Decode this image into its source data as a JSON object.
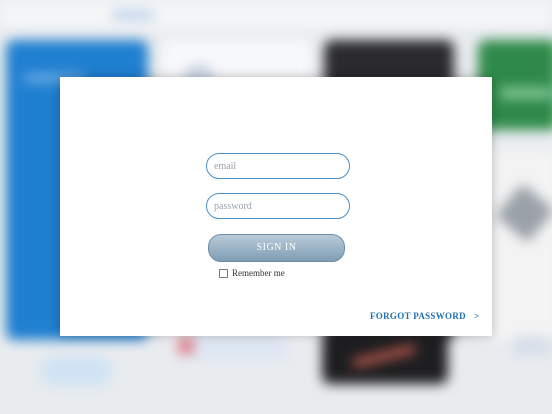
{
  "login": {
    "email_placeholder": "email",
    "password_placeholder": "password",
    "sign_in_label": "SIGN IN",
    "remember_me_label": "Remember me",
    "remember_me_checked": false,
    "forgot_password_label": "FORGOT PASSWORD",
    "forgot_arrow": ">"
  },
  "colors": {
    "field_border": "#4a90c8",
    "button_gradient_top": "#b9cbd9",
    "button_gradient_bottom": "#7f9db4",
    "link": "#2370b0"
  }
}
